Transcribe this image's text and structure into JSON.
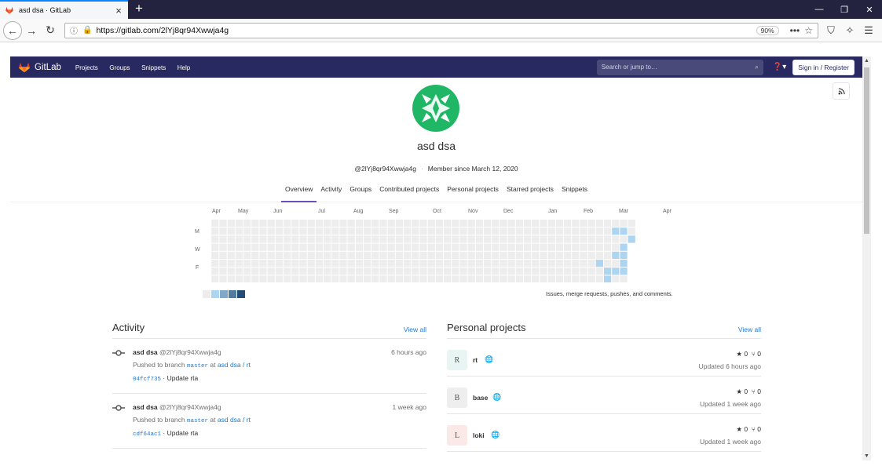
{
  "browser": {
    "tab_title": "asd dsa · GitLab",
    "url": "https://gitlab.com/2lYj8qr94Xwwja4g",
    "zoom": "90%"
  },
  "header": {
    "brand": "GitLab",
    "nav": [
      "Projects",
      "Groups",
      "Snippets",
      "Help"
    ],
    "search_placeholder": "Search or jump to…",
    "signin": "Sign in / Register"
  },
  "profile": {
    "name": "asd dsa",
    "handle": "@2lYj8qr94Xwwja4g",
    "member_since": "Member since March 12, 2020",
    "tabs": [
      "Overview",
      "Activity",
      "Groups",
      "Contributed projects",
      "Personal projects",
      "Starred projects",
      "Snippets"
    ],
    "active_tab": "Overview"
  },
  "calendar": {
    "months": [
      "Apr",
      "May",
      "Jun",
      "Jul",
      "Aug",
      "Sep",
      "Oct",
      "Nov",
      "Dec",
      "Jan",
      "Feb",
      "Mar",
      "Apr"
    ],
    "day_labels": [
      "M",
      "W",
      "F"
    ],
    "note": "Issues, merge requests, pushes, and comments.",
    "legend_colors": [
      "#ededed",
      "#acd5f2",
      "#7fa8c9",
      "#527ba0",
      "#254e77"
    ]
  },
  "activity": {
    "title": "Activity",
    "view_all": "View all",
    "events": [
      {
        "author": "asd dsa",
        "handle": "@2lYj8qr94Xwwja4g",
        "time": "6 hours ago",
        "pushed_prefix": "Pushed to branch",
        "branch": "master",
        "at": "at",
        "project": "asd dsa / rt",
        "sha": "04fcf735",
        "message": "· Update rta"
      },
      {
        "author": "asd dsa",
        "handle": "@2lYj8qr94Xwwja4g",
        "time": "1 week ago",
        "pushed_prefix": "Pushed to branch",
        "branch": "master",
        "at": "at",
        "project": "asd dsa / rt",
        "sha": "cdf64ac1",
        "message": "· Update rta"
      }
    ]
  },
  "projects": {
    "title": "Personal projects",
    "view_all": "View all",
    "items": [
      {
        "initial": "R",
        "name": "rt",
        "stars": "0",
        "forks": "0",
        "updated": "Updated 6 hours ago",
        "color": "#e8f5f3"
      },
      {
        "initial": "B",
        "name": "base",
        "stars": "0",
        "forks": "0",
        "updated": "Updated 1 week ago",
        "color": "#eeeeee"
      },
      {
        "initial": "L",
        "name": "loki",
        "stars": "0",
        "forks": "0",
        "updated": "Updated 1 week ago",
        "color": "#fbe9e7"
      }
    ]
  }
}
